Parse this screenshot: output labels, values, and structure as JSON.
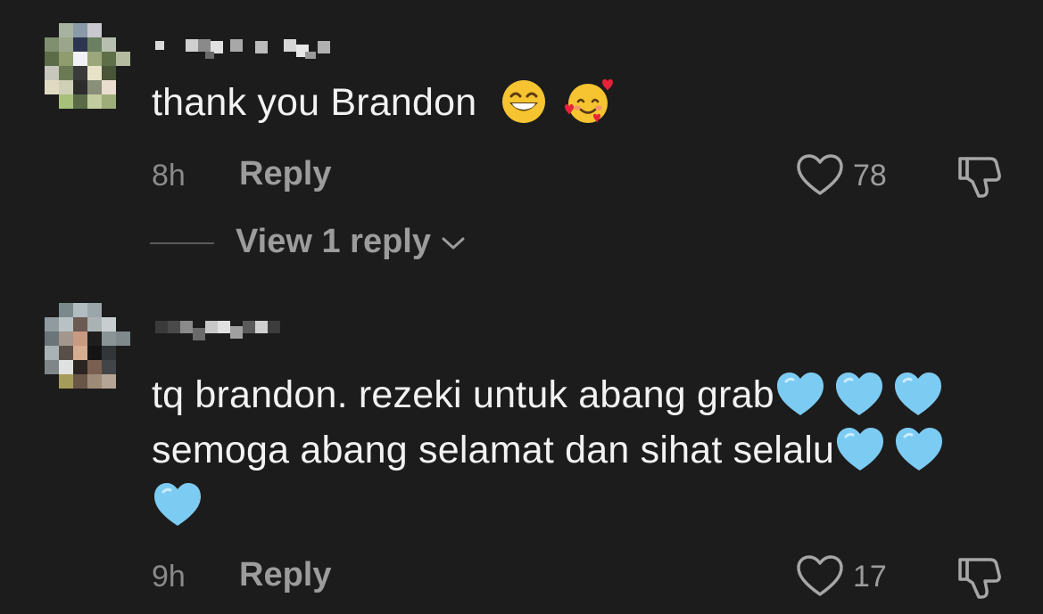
{
  "comments": [
    {
      "text": "thank you Brandon",
      "emoji": [
        "grinning-face",
        "smiling-face-with-hearts"
      ],
      "time": "8h",
      "reply_label": "Reply",
      "likes": "78",
      "replies_label": "View 1 reply"
    },
    {
      "text_line1": "tq brandon. rezeki untuk abang grab",
      "text_line2": "semoga abang selamat dan sihat selalu",
      "emoji": [
        "light-blue-heart",
        "light-blue-heart",
        "light-blue-heart",
        "light-blue-heart",
        "light-blue-heart",
        "light-blue-heart"
      ],
      "time": "9h",
      "reply_label": "Reply",
      "likes": "17"
    }
  ],
  "colors": {
    "background": "#1c1c1c",
    "text": "#f2f2f2",
    "muted": "#9c9c9c",
    "heart_blue": "#6ec6f0"
  }
}
